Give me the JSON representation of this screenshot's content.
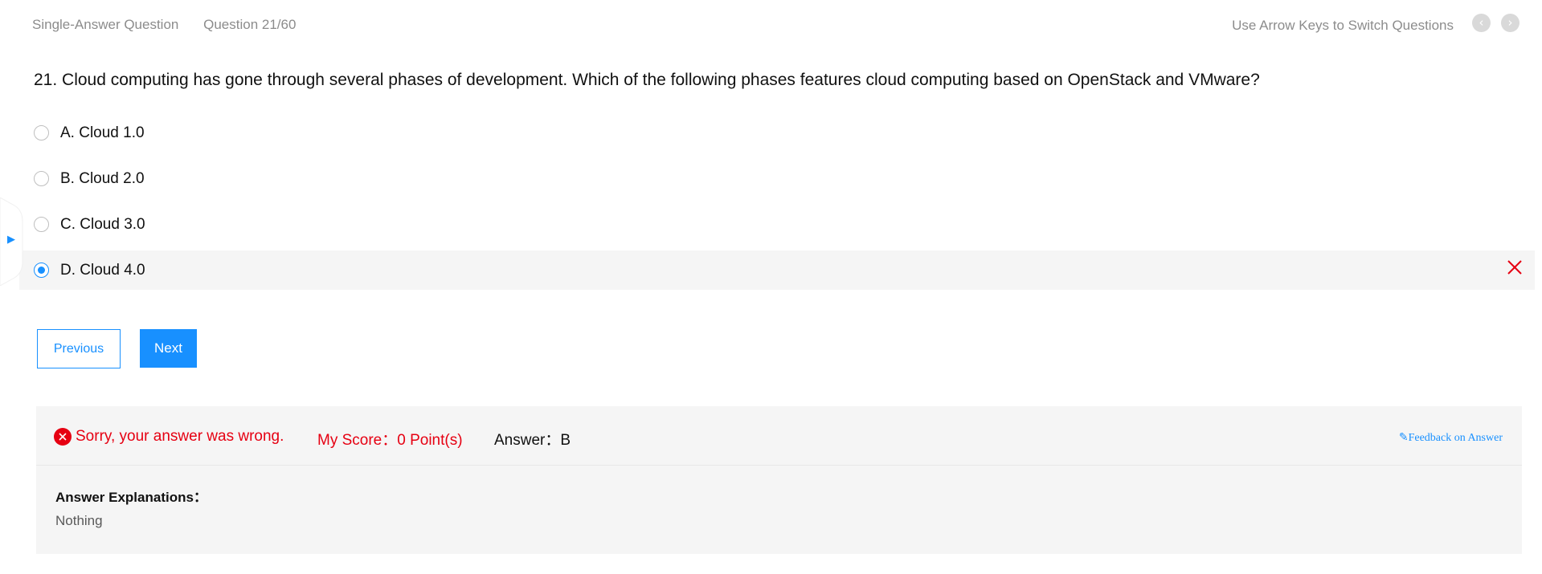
{
  "header": {
    "question_type": "Single-Answer Question",
    "question_counter": "Question 21/60",
    "hint": "Use Arrow Keys to Switch Questions"
  },
  "question": {
    "text": "21. Cloud computing has gone through several phases of development. Which of the following phases features cloud computing based on OpenStack and VMware?",
    "options": [
      {
        "label": "A. Cloud 1.0",
        "selected": false
      },
      {
        "label": "B. Cloud 2.0",
        "selected": false
      },
      {
        "label": "C. Cloud 3.0",
        "selected": false
      },
      {
        "label": "D. Cloud 4.0",
        "selected": true
      }
    ]
  },
  "buttons": {
    "previous": "Previous",
    "next": "Next"
  },
  "result": {
    "message": "Sorry, your answer was wrong.",
    "score": "My Score：0 Point(s)",
    "answer": "Answer：B",
    "feedback": "Feedback on Answer",
    "explanation_title": "Answer Explanations：",
    "explanation_body": "Nothing"
  },
  "colors": {
    "accent": "#1890ff",
    "error": "#e60012",
    "panel_bg": "#f5f5f5"
  },
  "icons": {
    "prev": "chevron-left-icon",
    "next": "chevron-right-icon",
    "wrong": "close-icon",
    "error": "error-circle-icon",
    "feedback": "edit-icon",
    "side": "triangle-right-icon"
  }
}
